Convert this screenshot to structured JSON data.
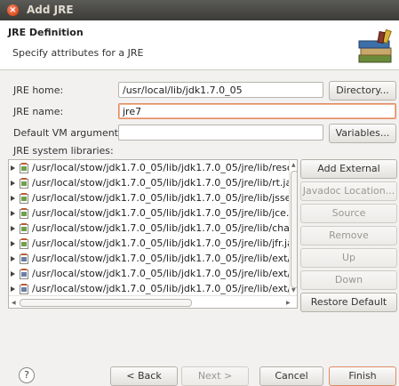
{
  "window": {
    "title": "Add JRE"
  },
  "header": {
    "title": "JRE Definition",
    "subtitle": "Specify attributes for a JRE"
  },
  "form": {
    "jre_home_label": "JRE home:",
    "jre_home_value": "/usr/local/lib/jdk1.7.0_05",
    "jre_name_label": "JRE name:",
    "jre_name_value": "jre7",
    "vm_args_label": "Default VM arguments:",
    "vm_args_value": "",
    "libs_label": "JRE system libraries:"
  },
  "buttons": {
    "directory": "Directory...",
    "variables": "Variables...",
    "add_external_jars": "Add External JARs...",
    "javadoc_location": "Javadoc Location...",
    "source_attachment": "Source Attachment...",
    "remove": "Remove",
    "up": "Up",
    "down": "Down",
    "restore_default": "Restore Default",
    "back": "< Back",
    "next": "Next >",
    "cancel": "Cancel",
    "finish": "Finish"
  },
  "libraries": [
    "/usr/local/stow/jdk1.7.0_05/lib/jdk1.7.0_05/jre/lib/resou",
    "/usr/local/stow/jdk1.7.0_05/lib/jdk1.7.0_05/jre/lib/rt.jar",
    "/usr/local/stow/jdk1.7.0_05/lib/jdk1.7.0_05/jre/lib/jsse.ja",
    "/usr/local/stow/jdk1.7.0_05/lib/jdk1.7.0_05/jre/lib/jce.jar",
    "/usr/local/stow/jdk1.7.0_05/lib/jdk1.7.0_05/jre/lib/charse",
    "/usr/local/stow/jdk1.7.0_05/lib/jdk1.7.0_05/jre/lib/jfr.jar",
    "/usr/local/stow/jdk1.7.0_05/lib/jdk1.7.0_05/jre/lib/ext/d",
    "/usr/local/stow/jdk1.7.0_05/lib/jdk1.7.0_05/jre/lib/ext/lo",
    "/usr/local/stow/jdk1.7.0_05/lib/jdk1.7.0_05/jre/lib/ext/su"
  ],
  "icons": {
    "close": "close-icon",
    "books": "books-icon",
    "jar": "jar-icon",
    "help": "help-icon"
  },
  "colors": {
    "titlebar": "#3c3b37",
    "close": "#e04d1f",
    "focus": "#e08b64",
    "finish_border": "#e08b64"
  }
}
